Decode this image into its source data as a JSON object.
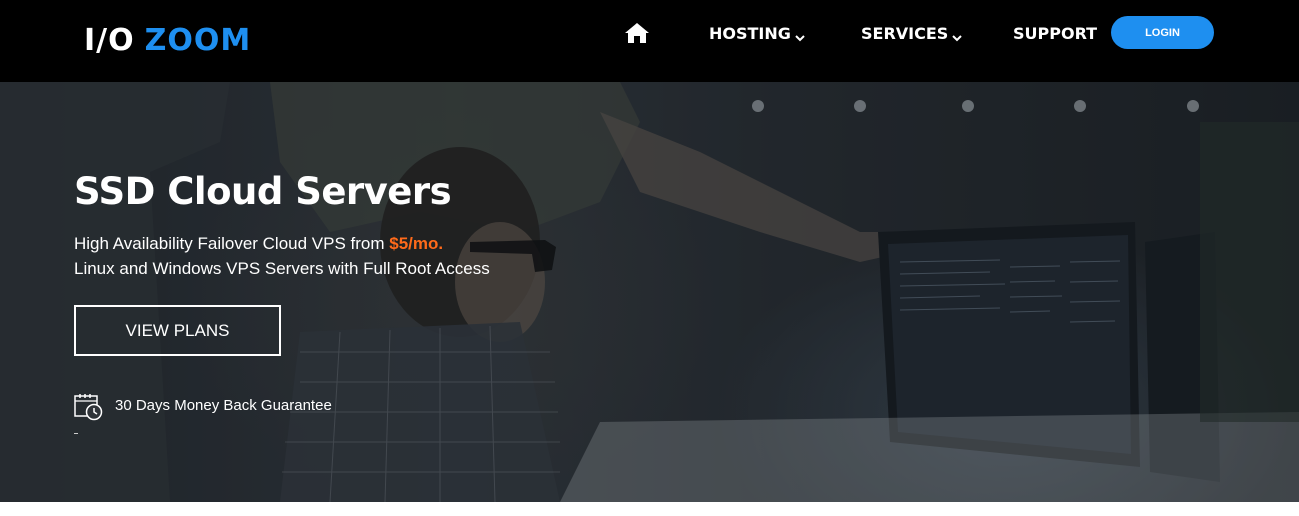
{
  "header": {
    "logo": {
      "part1": "I/O",
      "part2": "ZOOM"
    },
    "nav": {
      "home_icon": "home-icon",
      "hosting_label": "HOSTING",
      "services_label": "SERVICES",
      "support_label": "SUPPORT",
      "login_label": "LOGIN"
    }
  },
  "hero": {
    "title": "SSD Cloud Servers",
    "line1_prefix": "High Availability Failover Cloud VPS from ",
    "line1_price": "$5/mo.",
    "line2": "Linux and Windows VPS Servers with Full Root Access",
    "cta_label": "VIEW PLANS",
    "guarantee_icon": "calendar-clock-icon",
    "guarantee_text": "30 Days Money Back Guarantee"
  },
  "colors": {
    "accent": "#1e8ff0",
    "price": "#ff6a1a",
    "header_bg": "#000000"
  }
}
